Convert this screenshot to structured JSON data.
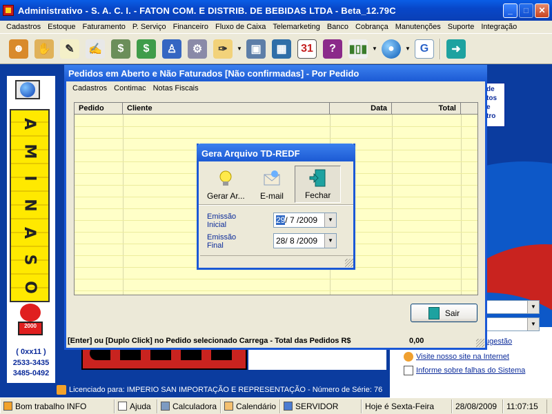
{
  "app": {
    "title": "Administrativo - S. A. C. I. - FATON COM. E DISTRIB. DE BEBIDAS LTDA - Beta_12.79C"
  },
  "menu": [
    "Cadastros",
    "Estoque",
    "Faturamento",
    "P. Serviço",
    "Financeiro",
    "Fluxo de Caixa",
    "Telemarketing",
    "Banco",
    "Cobrança",
    "Manutenções",
    "Suporte",
    "Integração"
  ],
  "toolbar": {
    "icons": [
      "users-icon",
      "handshake-icon",
      "sign-document-icon",
      "edit-document-icon",
      "money-bag-icon",
      "money-bills-icon",
      "user-tie-icon",
      "settings-gears-icon",
      "sign-icon",
      "computer-icon",
      "calculator-icon",
      "calendar-icon",
      "help-book-icon",
      "bar-chart-icon",
      "globe-icon",
      "google-icon",
      "exit-door-icon"
    ],
    "calendar_day": "31"
  },
  "left_panel": {
    "phone_ddd": "( 0xx11 )",
    "phone_1": "2533-3435",
    "phone_2": "3485-0492",
    "mascot_text": "2000"
  },
  "pedidos_window": {
    "title": "Pedidos em Aberto e Não Faturados [Não confirmadas] - Por Pedido",
    "menu": [
      "Cadastros",
      "Contimac",
      "Notas Fiscais"
    ],
    "columns": [
      "Pedido",
      "Cliente",
      "Data",
      "Total"
    ],
    "rows": [],
    "exit_label": "Sair",
    "status_text": "[Enter] ou [Duplo Click] no Pedido selecionado Carrega - Total das Pedidos R$",
    "total_value": "0,00"
  },
  "dialog": {
    "title": "Gera Arquivo TD-REDF",
    "buttons": [
      "Gerar Ar...",
      "E-mail",
      "Fechar"
    ],
    "start_label_1": "Emissão",
    "start_label_2": "Inicial",
    "start_day": "29",
    "start_rest": "/ 7 /2009",
    "end_label_1": "Emissão",
    "end_label_2": "Final",
    "end_date": "28/ 8 /2009"
  },
  "desktop": {
    "note_text": "de\ntos\ne\ntro",
    "links": [
      "ugestão",
      "Visite nosso site na Internet",
      "Informe sobre falhas do Sistema"
    ],
    "license_text": "Licenciado para: IMPERIO SAN IMPORTAÇÃO E REPRESENTAÇÃO - Número de Série: 76"
  },
  "statusbar": {
    "items": [
      "Bom trabalho INFO",
      "Ajuda",
      "Calculadora",
      "Calendário",
      "SERVIDOR",
      "Hoje é Sexta-Feira",
      "28/08/2009",
      "11:07:15"
    ]
  }
}
